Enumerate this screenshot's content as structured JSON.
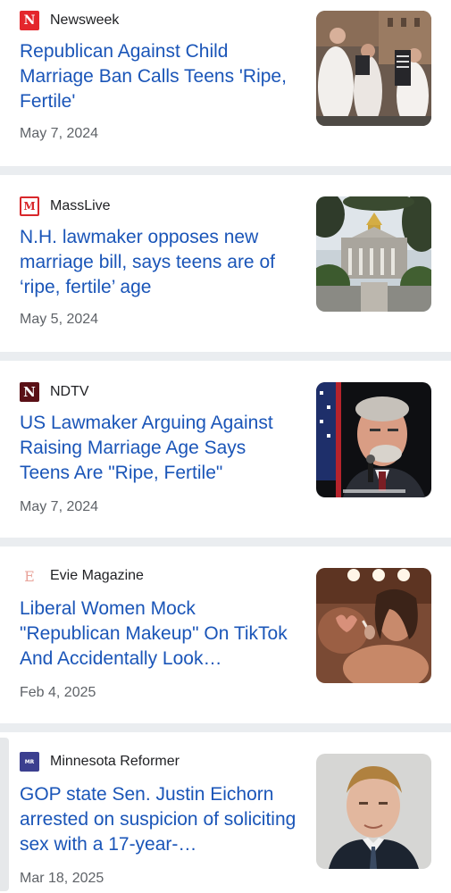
{
  "articles": [
    {
      "source": "Newsweek",
      "logo": {
        "glyph": "N",
        "icon": "newsweek-logo-icon",
        "bg": "#e4262c",
        "fg": "#ffffff"
      },
      "headline": "Republican Against Child Marriage Ban Calls Teens 'Ripe, Fertile'",
      "date": "May 7, 2024",
      "thumbnail": "protest-brides-photo"
    },
    {
      "source": "MassLive",
      "logo": {
        "glyph": "M",
        "icon": "masslive-logo-icon",
        "bg": "#ffffff",
        "fg": "#d8272b"
      },
      "headline": "N.H. lawmaker opposes new marriage bill, says teens are of ‘ripe, fertile’ age",
      "date": "May 5, 2024",
      "thumbnail": "state-house-photo"
    },
    {
      "source": "NDTV",
      "logo": {
        "glyph": "N",
        "icon": "ndtv-logo-icon",
        "bg": "#c41e24",
        "fg": "#ffffff"
      },
      "headline": "US Lawmaker Arguing Against Raising Marriage Age Says Teens Are \"Ripe, Fertile\"",
      "date": "May 7, 2024",
      "thumbnail": "lawmaker-speaking-photo"
    },
    {
      "source": "Evie Magazine",
      "logo": {
        "glyph": "E",
        "icon": "evie-logo-icon",
        "bg": "#ffffff",
        "fg": "#e8a39a"
      },
      "headline": "Liberal Women Mock \"Republican Makeup\" On TikTok And Accidentally Look…",
      "date": "Feb 4, 2025",
      "thumbnail": "makeup-mirror-photo"
    },
    {
      "source": "Minnesota Reformer",
      "logo": {
        "glyph": "MR",
        "icon": "minnesota-reformer-logo-icon",
        "bg": "#3b3f8f",
        "fg": "#ffffff"
      },
      "headline": "GOP state Sen. Justin Eichorn arrested on suspicion of soliciting sex with a 17-year-…",
      "date": "Mar 18, 2025",
      "thumbnail": "senator-portrait-photo"
    }
  ],
  "colors": {
    "headline": "#1a55b8",
    "date": "#5f6368",
    "source": "#202124",
    "separator": "#eaedf0"
  }
}
